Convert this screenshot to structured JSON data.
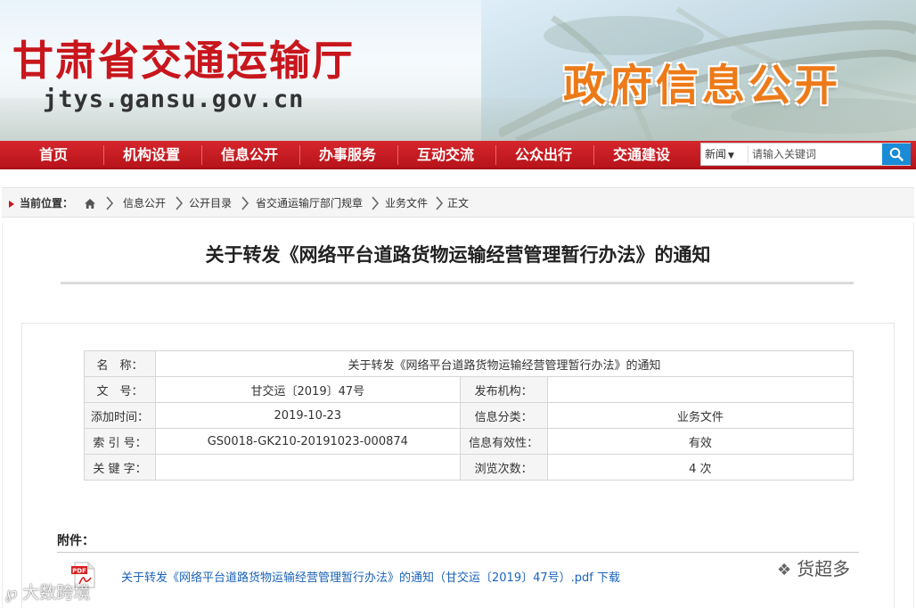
{
  "header": {
    "site_title": "甘肃省交通运输厅",
    "domain": "jtys.gansu.gov.cn",
    "section_banner": "政府信息公开"
  },
  "nav": {
    "items": [
      {
        "label": "首页"
      },
      {
        "label": "机构设置"
      },
      {
        "label": "信息公开"
      },
      {
        "label": "办事服务"
      },
      {
        "label": "互动交流"
      },
      {
        "label": "公众出行"
      },
      {
        "label": "交通建设"
      }
    ]
  },
  "search": {
    "scope_selected": "新闻",
    "placeholder": "请输入关键词",
    "icon": "search-icon"
  },
  "breadcrumb": {
    "label": "当前位置：",
    "home_icon": "home-icon",
    "items": [
      "信息公开",
      "公开目录",
      "省交通运输厅部门规章",
      "业务文件",
      "正文"
    ]
  },
  "document": {
    "title": "关于转发《网络平台道路货物运输经营管理暂行办法》的通知",
    "meta": {
      "name_label": "名　称：",
      "name_value": "关于转发《网络平台道路货物运输经营管理暂行办法》的通知",
      "doc_no_label": "文　号：",
      "doc_no_value": "甘交运〔2019〕47号",
      "publisher_label": "发布机构：",
      "publisher_value": "",
      "added_label": "添加时间：",
      "added_value": "2019-10-23",
      "category_label": "信息分类：",
      "category_value": "业务文件",
      "index_label": "索 引 号：",
      "index_value": "GS0018-GK210-20191023-000874",
      "validity_label": "信息有效性：",
      "validity_value": "有效",
      "keywords_label": "关 键 字：",
      "keywords_value": "",
      "views_label": "浏览次数：",
      "views_value": "4 次"
    }
  },
  "attachments": {
    "label": "附件：",
    "items": [
      {
        "text": "关于转发《网络平台道路货物运输经营管理暂行办法》的通知（甘交运〔2019〕47号）.pdf 下载",
        "icon": "pdf-icon"
      }
    ]
  },
  "watermarks": {
    "left": "大数跨境",
    "right": "货超多"
  },
  "colors": {
    "brand_red": "#c8161d",
    "banner_orange": "#ed7a18",
    "search_blue": "#1a8bd6",
    "link_blue": "#1b63b8"
  }
}
